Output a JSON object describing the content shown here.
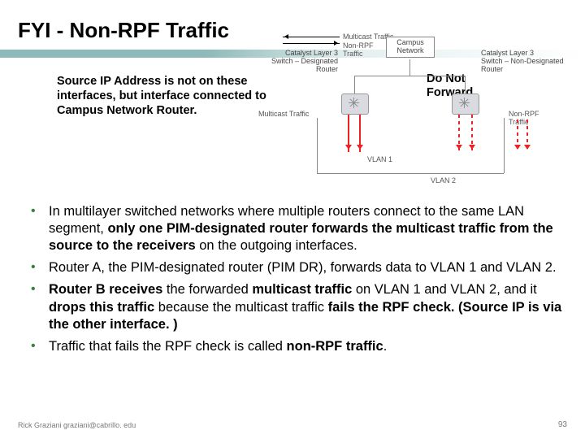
{
  "title": "FYI - Non-RPF Traffic",
  "callout": "Source IP Address is not on these interfaces, but interface connected to Campus Network Router.",
  "donot": "Do Not\nForward",
  "diagram": {
    "top_labels": {
      "multicast": "Multicast Traffic",
      "nonrpf": "Non-RPF\nTraffic"
    },
    "campus": "Campus\nNetwork",
    "switch_a": "Catalyst Layer 3\nSwitch – Designated\nRouter",
    "switch_b": "Catalyst Layer 3\nSwitch – Non-Designated\nRouter",
    "side_label": "Multicast Traffic",
    "nonrpf_side": "Non-RPF\nTraffic",
    "vlan1": "VLAN 1",
    "vlan2": "VLAN 2"
  },
  "bullets": [
    {
      "pre": "In multilayer switched networks where multiple routers connect to the same LAN segment, ",
      "bold": "only one PIM-designated router forwards the multicast traffic from the source to the receivers",
      "post": " on the outgoing interfaces."
    },
    {
      "pre": "Router A, the PIM-designated router (PIM DR), forwards data to VLAN 1 and VLAN 2.",
      "bold": "",
      "post": ""
    },
    {
      "html": true,
      "text": "<b>Router B receives</b> the forwarded <b>multicast traffic</b> on VLAN 1 and VLAN 2, and it <b>drops this traffic</b> because the multicast traffic <b>fails the RPF check. (Source IP is via the other interface. )</b>"
    },
    {
      "pre": "Traffic that fails the RPF check is called ",
      "bold": "non-RPF traffic",
      "post": "."
    }
  ],
  "footer": {
    "left": "Rick Graziani  graziani@cabrillo. edu",
    "page": "93"
  }
}
